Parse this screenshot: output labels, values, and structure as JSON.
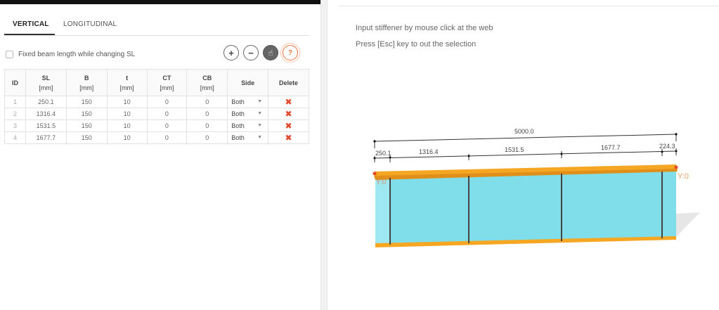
{
  "tabs": {
    "vertical": "VERTICAL",
    "longitudinal": "LONGITUDINAL"
  },
  "options": {
    "fixed_beam_label": "Fixed beam length while changing SL",
    "fixed_beam_checked": false
  },
  "toolbar": {
    "add": "+",
    "remove": "−",
    "pointer": "☝",
    "help": "?"
  },
  "table": {
    "headers": {
      "id": "ID",
      "sl": "SL",
      "sl_unit": "[mm]",
      "b": "B",
      "b_unit": "[mm]",
      "t": "t",
      "t_unit": "[mm]",
      "ct": "CT",
      "ct_unit": "[mm]",
      "cb": "CB",
      "cb_unit": "[mm]",
      "side": "Side",
      "delete": "Delete"
    },
    "rows": [
      {
        "id": "1",
        "sl": "250.1",
        "b": "150",
        "t": "10",
        "ct": "0",
        "cb": "0",
        "side": "Both",
        "del": "✖"
      },
      {
        "id": "2",
        "sl": "1316.4",
        "b": "150",
        "t": "10",
        "ct": "0",
        "cb": "0",
        "side": "Both",
        "del": "✖"
      },
      {
        "id": "3",
        "sl": "1531.5",
        "b": "150",
        "t": "10",
        "ct": "0",
        "cb": "0",
        "side": "Both",
        "del": "✖"
      },
      {
        "id": "4",
        "sl": "1677.7",
        "b": "150",
        "t": "10",
        "ct": "0",
        "cb": "0",
        "side": "Both",
        "del": "✖"
      }
    ]
  },
  "instructions": {
    "line1": "Input stiffener by mouse click at the web",
    "line2": "Press [Esc] key to out the selection"
  },
  "drawing": {
    "total_length": "5000.0",
    "segments": [
      "250.1",
      "1316.4",
      "1531.5",
      "1677.7",
      "224.3"
    ],
    "left_axis_label": "Y:0",
    "right_axis_label": "Y:0",
    "colors": {
      "flange": "#f5a623",
      "web": "#7fdeea",
      "stiffener": "#444444",
      "axis": "#e04a2a"
    }
  }
}
